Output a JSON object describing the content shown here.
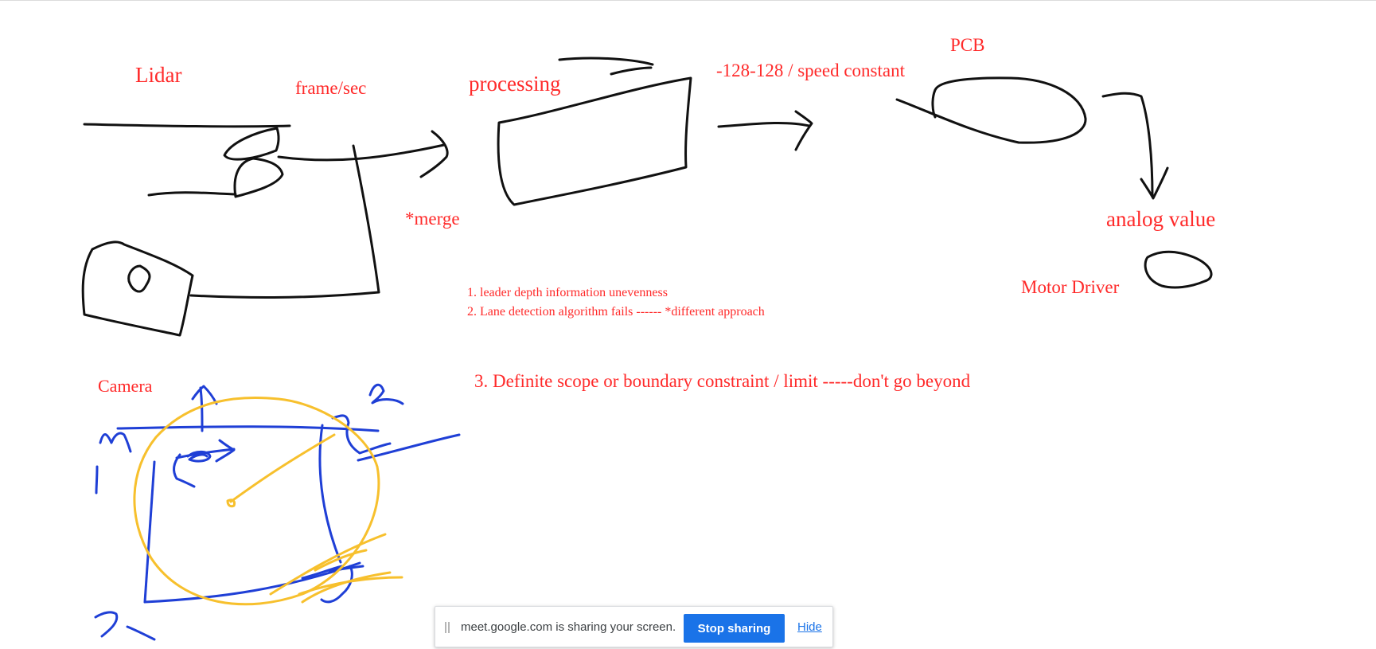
{
  "whiteboard": {
    "labels": {
      "lidar": "Lidar",
      "frame_rate": "frame/sec",
      "processing": "processing",
      "range": "-128-128  / speed constant",
      "pcb": "PCB",
      "merge": "*merge",
      "analog": "analog value",
      "motor_driver": "Motor Driver",
      "camera": "Camera"
    },
    "notes": [
      "1. leader depth information unevenness",
      "2. Lane detection algorithm fails  ------  *different approach",
      "3.  Definite scope or boundary constraint / limit -----don't go beyond"
    ],
    "colors": {
      "text": "#ff2a2a",
      "ink_black": "#111111",
      "ink_blue": "#1f3fd6",
      "ink_yellow": "#f7c02d"
    }
  },
  "share_bar": {
    "message": "meet.google.com is sharing your screen.",
    "stop_label": "Stop sharing",
    "hide_label": "Hide",
    "grip_icon": "drag-handle-icon",
    "accent": "#1a73e8"
  }
}
